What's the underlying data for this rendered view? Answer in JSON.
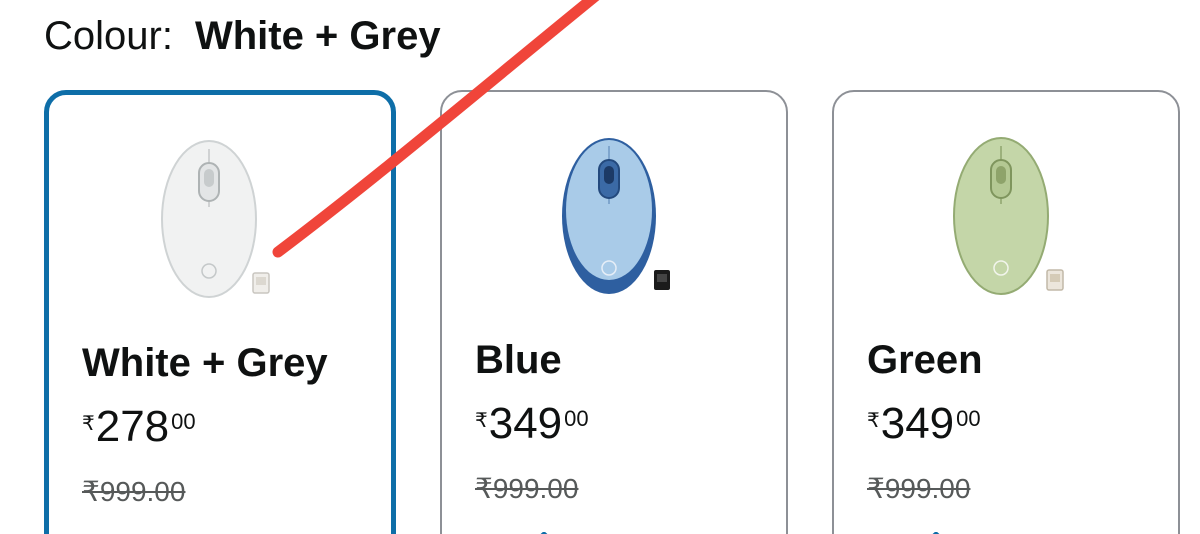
{
  "colour_selector": {
    "label": "Colour:",
    "selected_value": "White + Grey"
  },
  "swatches": [
    {
      "name": "White + Grey",
      "price_symbol": "₹",
      "price_whole": "278",
      "price_fraction": "00",
      "mrp": "₹999.00",
      "selected": true,
      "body_color": "#f1f2f2",
      "accent_color": "#cfd3d4"
    },
    {
      "name": "Blue",
      "price_symbol": "₹",
      "price_whole": "349",
      "price_fraction": "00",
      "mrp": "₹999.00",
      "selected": false,
      "body_color": "#a9cbe8",
      "accent_color": "#2e5fa0"
    },
    {
      "name": "Green",
      "price_symbol": "₹",
      "price_whole": "349",
      "price_fraction": "00",
      "mrp": "₹999.00",
      "selected": false,
      "body_color": "#c4d6a8",
      "accent_color": "#94ab73"
    }
  ],
  "colors": {
    "selected_border": "#0e6ea8",
    "unselected_border": "#8d9096",
    "annotation_stroke": "#f0453a"
  }
}
